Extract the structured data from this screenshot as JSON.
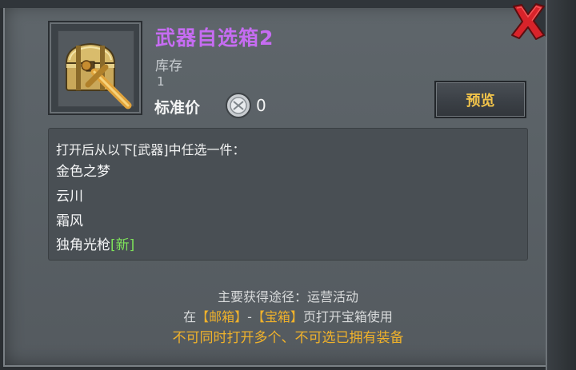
{
  "item": {
    "name": "武器自选箱2",
    "stock_label": "库存",
    "stock_value": "1",
    "price_label": "标准价",
    "price_value": "0"
  },
  "preview_label": "预览",
  "description": {
    "header": "打开后从以下[武器]中任选一件：",
    "options": [
      "金色之梦",
      "云川",
      "霜风",
      "独角光枪"
    ],
    "new_tag": "[新]"
  },
  "source": {
    "main": "主要获得途径：运营活动",
    "prefix": "在",
    "mailbox": "【邮箱】",
    "dash": "-",
    "chest": "【宝箱】",
    "suffix": "页打开宝箱使用",
    "warning": "不可同时打开多个、不可选已拥有装备"
  },
  "colors": {
    "item_name": "#c66cf2",
    "accent_gold": "#f0b22b",
    "new_green": "#7ee25a",
    "close_red": "#d8232a"
  },
  "icons": [
    "close-icon",
    "treasure-chest-icon",
    "sword-icon",
    "silver-coin-icon"
  ]
}
